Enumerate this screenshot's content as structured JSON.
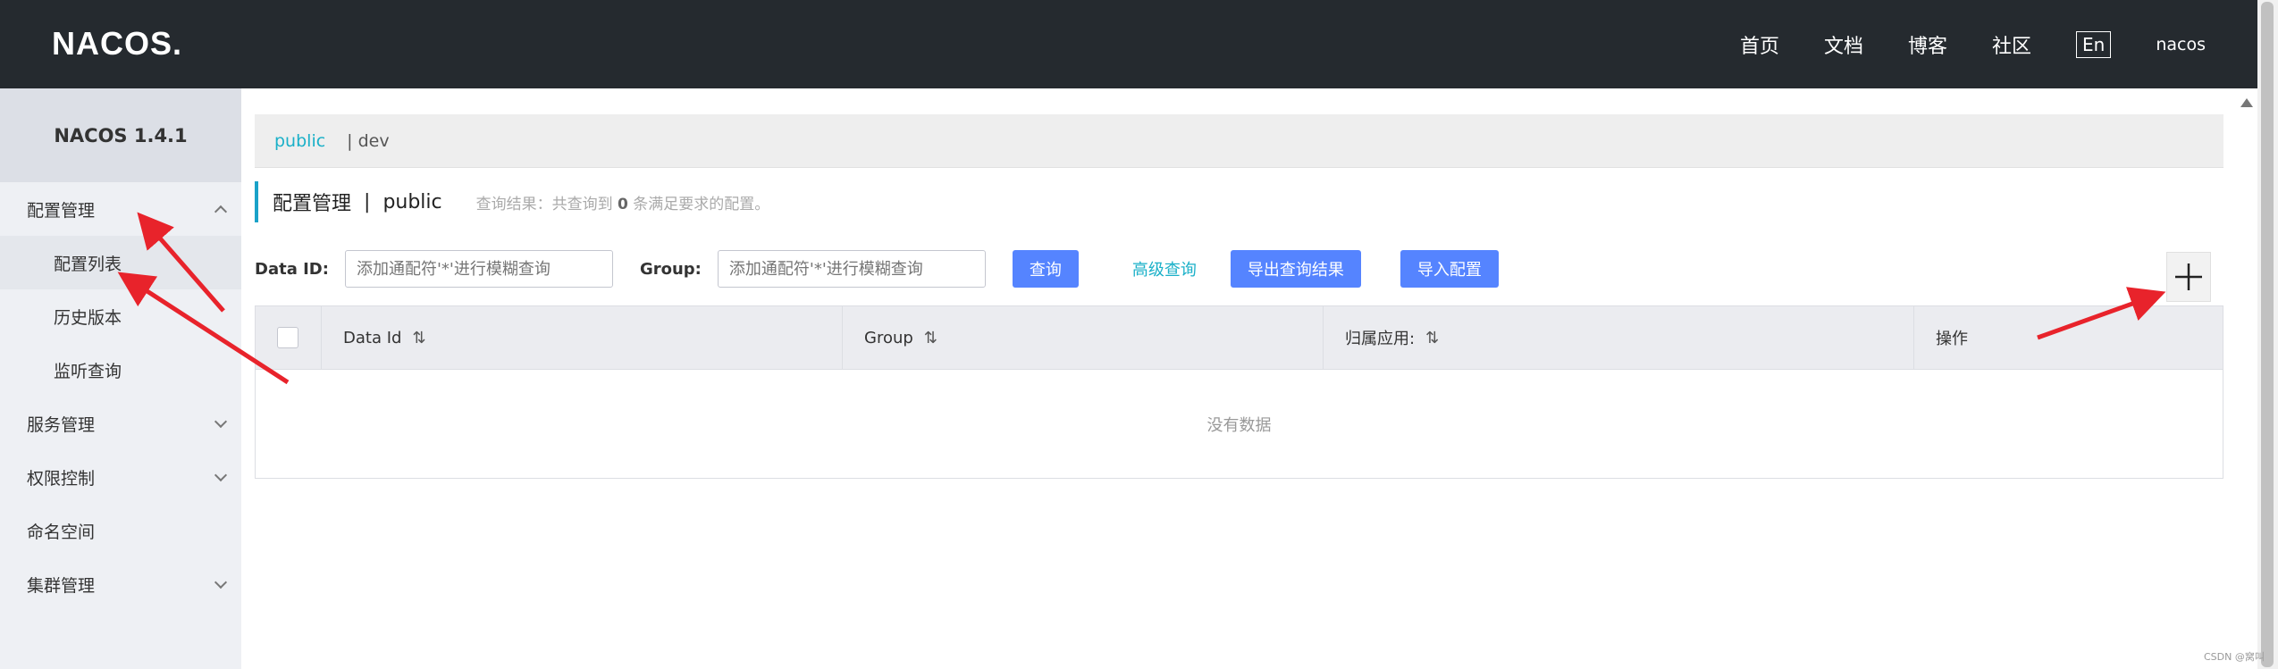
{
  "header": {
    "logo": "NACOS.",
    "nav": [
      "首页",
      "文档",
      "博客",
      "社区"
    ],
    "lang": "En",
    "user": "nacos"
  },
  "sidebar": {
    "title": "NACOS 1.4.1",
    "config_group": "配置管理",
    "config_items": [
      "配置列表",
      "历史版本",
      "监听查询"
    ],
    "service_group": "服务管理",
    "auth_group": "权限控制",
    "namespace": "命名空间",
    "cluster_group": "集群管理"
  },
  "breadcrumb": {
    "public": "public",
    "separator": "|",
    "dev": "dev"
  },
  "page": {
    "title": "配置管理",
    "title_sep": "|",
    "namespace": "public",
    "result_prefix": "查询结果：共查询到",
    "result_count": "0",
    "result_suffix": "条满足要求的配置。"
  },
  "filters": {
    "data_id_label": "Data ID:",
    "data_id_placeholder": "添加通配符'*'进行模糊查询",
    "group_label": "Group:",
    "group_placeholder": "添加通配符'*'进行模糊查询",
    "query_button": "查询",
    "advanced_link": "高级查询",
    "export_button": "导出查询结果",
    "import_button": "导入配置",
    "add_button": "+"
  },
  "table": {
    "columns": [
      "Data Id",
      "Group",
      "归属应用:",
      "操作"
    ],
    "sort_icon": "⇅",
    "empty_text": "没有数据"
  },
  "watermark": "CSDN @窝叫",
  "colors": {
    "header_bg": "#252a2f",
    "primary": "#5584ff",
    "link": "#1ab0c8",
    "annotation": "#e8232b"
  }
}
